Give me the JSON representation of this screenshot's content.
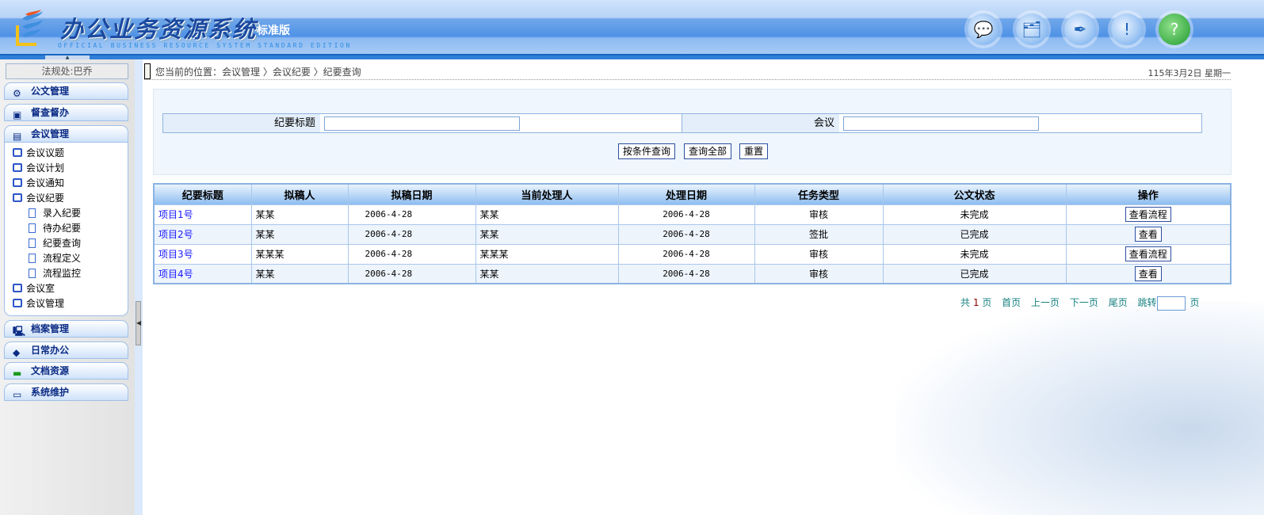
{
  "header": {
    "title": "办公业务资源系统",
    "edition": "标准版",
    "subtitle": "OFFICIAL BUSINESS RESOURCE SYSTEM STANDARD EDITION",
    "icons": [
      "message-icon",
      "documents-icon",
      "pen-globe-icon",
      "user-alert-icon",
      "help-search-icon"
    ]
  },
  "sidebar": {
    "user": "法规处:巴乔",
    "groups": [
      {
        "label": "公文管理",
        "icon": "document-gear-icon"
      },
      {
        "label": "督查督办",
        "icon": "supervise-icon"
      },
      {
        "label": "会议管理",
        "icon": "meeting-icon"
      },
      {
        "label": "档案管理",
        "icon": "archive-computer-icon"
      },
      {
        "label": "日常办公",
        "icon": "daily-office-icon"
      },
      {
        "label": "文档资源",
        "icon": "document-resource-icon"
      },
      {
        "label": "系统维护",
        "icon": "system-maintenance-icon"
      }
    ],
    "items": [
      "会议议题",
      "会议计划",
      "会议通知",
      "会议纪要",
      "会议室",
      "会议管理"
    ],
    "subitems": [
      "录入纪要",
      "待办纪要",
      "纪要查询",
      "流程定义",
      "流程监控"
    ]
  },
  "breadcrumb": {
    "path": "您当前的位置：会议管理 〉会议纪要 〉纪要查询",
    "date": "115年3月2日  星期一"
  },
  "search": {
    "title_label": "纪要标题",
    "title_value": "",
    "meeting_label": "会议",
    "meeting_value": "",
    "query_button": "按条件查询",
    "query_all_button": "查询全部",
    "reset_button": "重置"
  },
  "table": {
    "headers": [
      "纪要标题",
      "拟稿人",
      "拟稿日期",
      "当前处理人",
      "处理日期",
      "任务类型",
      "公文状态",
      "操作"
    ],
    "rows": [
      {
        "title": "项目1号",
        "drafter": "某某",
        "draft_date": "2006-4-28",
        "handler": "某某",
        "handle_date": "2006-4-28",
        "task_type": "审核",
        "status": "未完成",
        "action": "查看流程"
      },
      {
        "title": "项目2号",
        "drafter": "某某",
        "draft_date": "2006-4-28",
        "handler": "某某",
        "handle_date": "2006-4-28",
        "task_type": "签批",
        "status": "已完成",
        "action": "查看"
      },
      {
        "title": "项目3号",
        "drafter": "某某某",
        "draft_date": "2006-4-28",
        "handler": "某某某",
        "handle_date": "2006-4-28",
        "task_type": "审核",
        "status": "未完成",
        "action": "查看流程"
      },
      {
        "title": "项目4号",
        "drafter": "某某",
        "draft_date": "2006-4-28",
        "handler": "某某",
        "handle_date": "2006-4-28",
        "task_type": "审核",
        "status": "已完成",
        "action": "查看"
      }
    ]
  },
  "pager": {
    "total_prefix": "共",
    "total_pages": "1",
    "total_suffix": "页",
    "first": "首页",
    "prev": "上一页",
    "next": "下一页",
    "last": "尾页",
    "jump": "跳转",
    "jump_value": "",
    "page_suffix": "页"
  }
}
